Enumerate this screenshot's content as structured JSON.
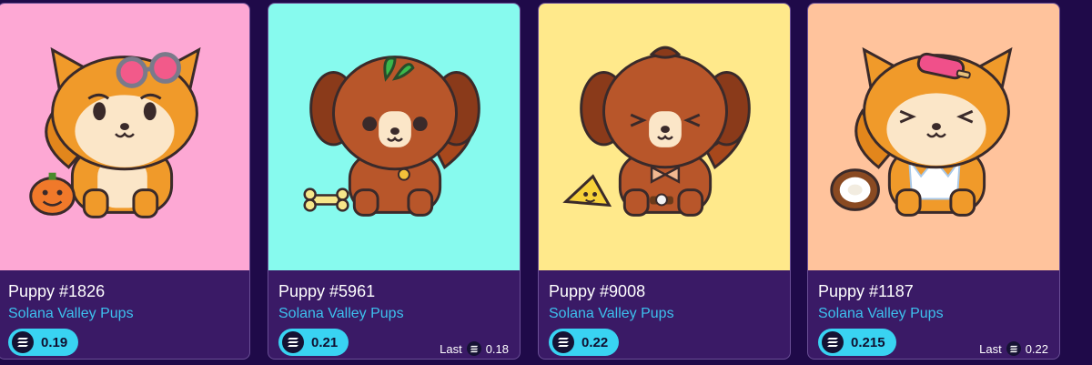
{
  "cards": [
    {
      "title": "Puppy #1826",
      "collection": "Solana Valley Pups",
      "price": "0.19",
      "background": "#fda8d4",
      "dog": "shiba",
      "accessory": "pink-sunglasses",
      "item": "pumpkin",
      "expression": "cute-eyes"
    },
    {
      "title": "Puppy #5961",
      "collection": "Solana Valley Pups",
      "price": "0.21",
      "last_label": "Last",
      "last_price": "0.18",
      "background": "#87faee",
      "dog": "brown-spaniel",
      "accessory": "green-sprout",
      "item": "bone",
      "expression": "round-eyes"
    },
    {
      "title": "Puppy #9008",
      "collection": "Solana Valley Pups",
      "price": "0.22",
      "background": "#ffe98b",
      "dog": "brown-spaniel",
      "accessory": "bowtie",
      "item": "cheese",
      "expression": "squint-eyes"
    },
    {
      "title": "Puppy #1187",
      "collection": "Solana Valley Pups",
      "price": "0.215",
      "last_label": "Last",
      "last_price": "0.22",
      "background": "#ffc39c",
      "dog": "shiba",
      "accessory": "popsicle",
      "item": "coconut",
      "expression": "squint-eyes"
    }
  ],
  "colors": {
    "page_background": "#1f0a49",
    "card_info_background": "#3a1a66",
    "price_pill": "#39d3f2",
    "collection_text": "#3dc0ee"
  },
  "icons": {
    "currency": "solana-icon"
  }
}
